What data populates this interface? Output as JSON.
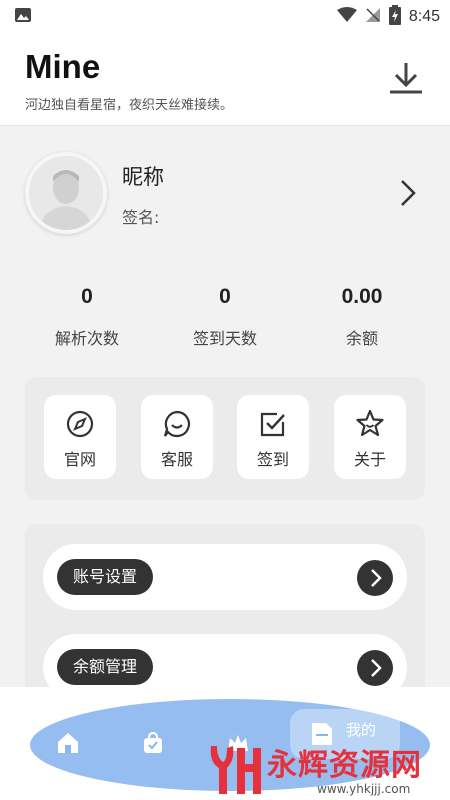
{
  "status": {
    "time": "8:45"
  },
  "header": {
    "title": "Mine",
    "subtitle": "河边独自看星宿，夜织天丝难接续。"
  },
  "profile": {
    "nickname": "昵称",
    "signature": "签名:"
  },
  "stats": [
    {
      "value": "0",
      "label": "解析次数"
    },
    {
      "value": "0",
      "label": "签到天数"
    },
    {
      "value": "0.00",
      "label": "余额"
    }
  ],
  "quick_actions": [
    {
      "label": "官网",
      "icon": "compass-icon"
    },
    {
      "label": "客服",
      "icon": "chat-smile-icon"
    },
    {
      "label": "签到",
      "icon": "checkbox-icon"
    },
    {
      "label": "关于",
      "icon": "star-icon"
    }
  ],
  "menu": [
    {
      "label": "账号设置"
    },
    {
      "label": "余额管理"
    }
  ],
  "nav": {
    "mine_label": "我的"
  },
  "watermark": {
    "text": "永辉资源网",
    "url": "www.yhkjjj.com"
  },
  "colors": {
    "accent": "#8ab6ee",
    "dark": "#333333",
    "watermark": "#e5313c"
  }
}
